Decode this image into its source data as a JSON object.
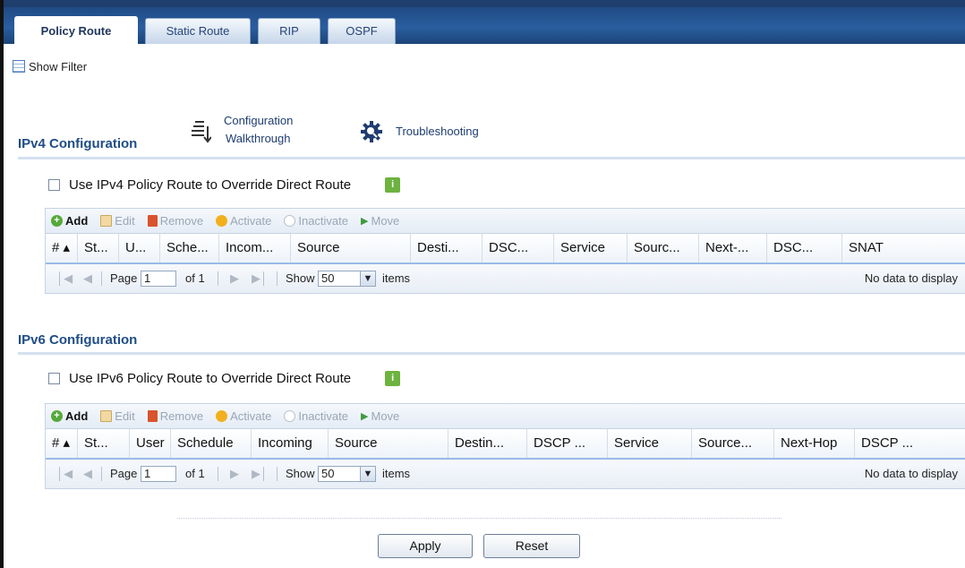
{
  "tabs": [
    {
      "label": "Policy Route",
      "active": true
    },
    {
      "label": "Static Route",
      "active": false
    },
    {
      "label": "RIP",
      "active": false
    },
    {
      "label": "OSPF",
      "active": false
    }
  ],
  "show_filter": "Show Filter",
  "ipv4": {
    "title": "IPv4 Configuration",
    "config_walkthrough_line1": "Configuration",
    "config_walkthrough_line2": "Walkthrough",
    "troubleshooting": "Troubleshooting",
    "override_label": "Use IPv4 Policy Route to Override Direct Route",
    "toolbar": {
      "add": "Add",
      "edit": "Edit",
      "remove": "Remove",
      "activate": "Activate",
      "inactivate": "Inactivate",
      "move": "Move"
    },
    "columns": [
      "# ▴",
      "St...",
      "U...",
      "Sche...",
      "Incom...",
      "Source",
      "Desti...",
      "DSC...",
      "Service",
      "Sourc...",
      "Next-...",
      "DSC...",
      "SNAT"
    ],
    "pager": {
      "page_label": "Page",
      "page_value": "1",
      "of_label": "of 1",
      "show_label": "Show",
      "show_value": "50",
      "items_label": "items",
      "empty_msg": "No data to display"
    }
  },
  "ipv6": {
    "title": "IPv6 Configuration",
    "override_label": "Use IPv6 Policy Route to Override Direct Route",
    "toolbar": {
      "add": "Add",
      "edit": "Edit",
      "remove": "Remove",
      "activate": "Activate",
      "inactivate": "Inactivate",
      "move": "Move"
    },
    "columns": [
      "# ▴",
      "St...",
      "User",
      "Schedule",
      "Incoming",
      "Source",
      "Destin...",
      "DSCP ...",
      "Service",
      "Source...",
      "Next-Hop",
      "DSCP ..."
    ],
    "pager": {
      "page_label": "Page",
      "page_value": "1",
      "of_label": "of 1",
      "show_label": "Show",
      "show_value": "50",
      "items_label": "items",
      "empty_msg": "No data to display"
    }
  },
  "buttons": {
    "apply": "Apply",
    "reset": "Reset"
  },
  "colors": {
    "tabbar": "#2a5e9e",
    "section_title": "#1f4d87",
    "add_icon": "#55a93a",
    "remove_icon": "#d9532c",
    "activate_icon": "#f2b01e",
    "info_icon": "#6db33f"
  },
  "icons": [
    "grid-filter-icon",
    "walkthrough-icon",
    "gear-troubleshoot-icon",
    "add-icon",
    "edit-icon",
    "remove-icon",
    "activate-icon",
    "inactivate-icon",
    "move-icon",
    "info-icon",
    "first-page-icon",
    "prev-page-icon",
    "next-page-icon",
    "last-page-icon",
    "chevron-down-icon"
  ]
}
